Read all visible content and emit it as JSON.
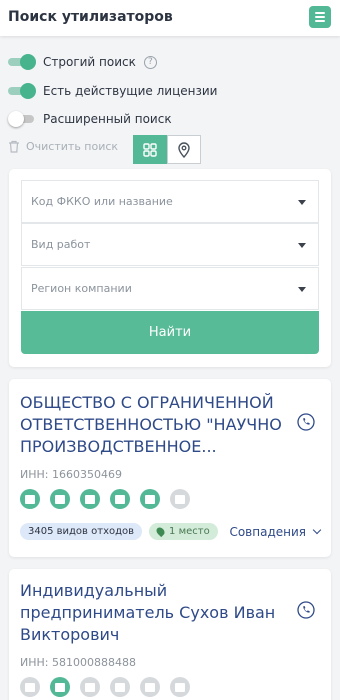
{
  "header": {
    "title": "Поиск утилизаторов",
    "menu_icon": "hamburger-icon"
  },
  "filters": {
    "strict_search": {
      "label": "Строгий поиск",
      "on": true
    },
    "has_licenses": {
      "label": "Есть действущие лицензии",
      "on": true
    },
    "extended_search": {
      "label": "Расширенный поиск",
      "on": false
    },
    "clear_label": "Очистить поиск",
    "views": [
      "grid-icon",
      "map-pin-icon"
    ]
  },
  "search": {
    "fkko_placeholder": "Код ФККО или название",
    "work_type_placeholder": "Вид работ",
    "region_placeholder": "Регион компании",
    "find_label": "Найти"
  },
  "results": [
    {
      "name": "ОБЩЕСТВО С ОГРАНИЧЕННОЙ ОТВЕТСТВЕННОСТЬЮ \"НАУЧНО ПРОИЗВОДСТВЕННОЕ...",
      "inn": "ИНН: 1660350469",
      "category_states": [
        true,
        true,
        true,
        true,
        true,
        false
      ],
      "waste_types": "3405 видов отходов",
      "place": "1 место",
      "matches_label": "Совпадения"
    },
    {
      "name": "Индивидуальный предприниматель Сухов Иван Викторович",
      "inn": "ИНН: 581000888488",
      "category_states": [
        false,
        true,
        false,
        false,
        false,
        false
      ]
    }
  ],
  "colors": {
    "accent": "#53b895",
    "link": "#2f4a88"
  }
}
